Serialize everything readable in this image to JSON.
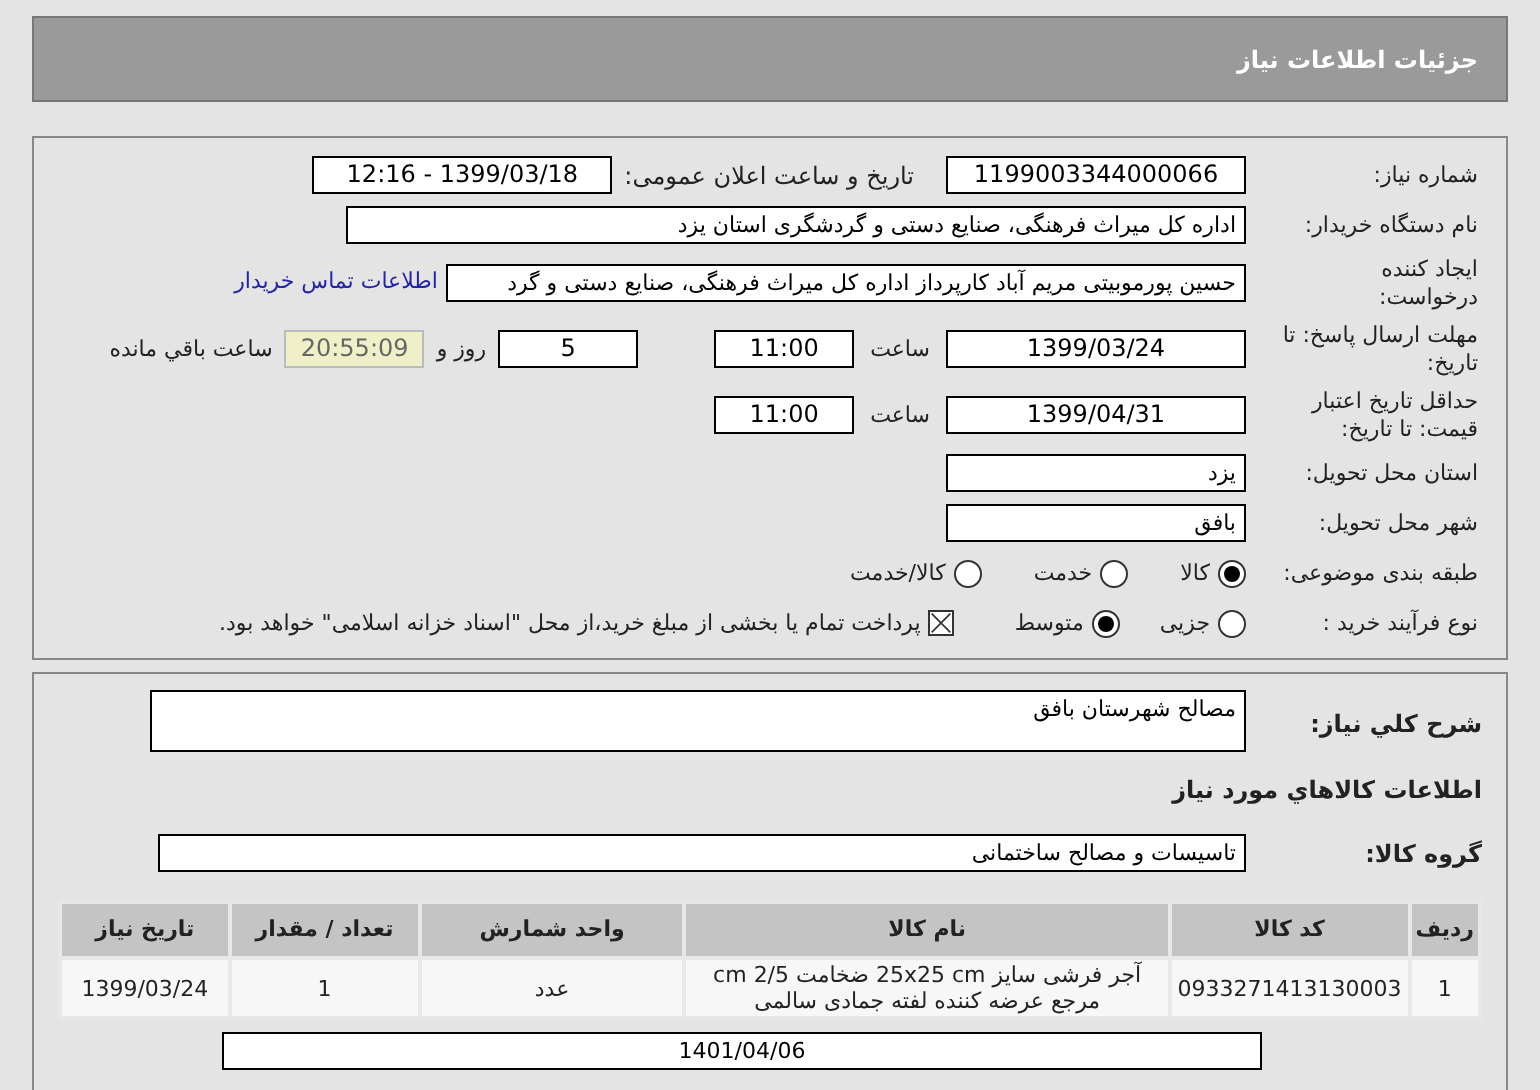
{
  "header": {
    "title": "جزئیات اطلاعات نیاز"
  },
  "need_number": {
    "label": "شماره نیاز:",
    "value": "1199003344000066"
  },
  "announce": {
    "label": "تاریخ و ساعت اعلان عمومی:",
    "value": "1399/03/18 - 12:16"
  },
  "buyer": {
    "label": "نام دستگاه خریدار:",
    "value": "اداره کل میراث فرهنگی، صنایع دستی و گردشگری استان یزد"
  },
  "creator": {
    "label": "ایجاد کننده درخواست:",
    "value": "حسین پورموبیتی مریم آباد کارپرداز اداره کل میراث فرهنگی، صنایع دستی و گرد",
    "link": "اطلاعات تماس خریدار"
  },
  "deadline": {
    "label": "مهلت ارسال پاسخ: تا تاریخ:",
    "date": "1399/03/24",
    "time_label": "ساعت",
    "time": "11:00",
    "days": "5",
    "days_label": "روز و",
    "remaining": "20:55:09",
    "remaining_label": "ساعت باقي مانده"
  },
  "validity": {
    "label": "حداقل تاریخ اعتبار قیمت: تا تاریخ:",
    "date": "1399/04/31",
    "time_label": "ساعت",
    "time": "11:00"
  },
  "province": {
    "label": "استان محل تحویل:",
    "value": "یزد"
  },
  "city": {
    "label": "شهر محل تحویل:",
    "value": "بافق"
  },
  "category": {
    "label": "طبقه بندی موضوعی:",
    "options": [
      {
        "label": "کالا",
        "selected": true
      },
      {
        "label": "خدمت",
        "selected": false
      },
      {
        "label": "کالا/خدمت",
        "selected": false
      }
    ]
  },
  "process": {
    "label": "نوع فرآیند خرید :",
    "options": [
      {
        "label": "جزیی",
        "selected": false
      },
      {
        "label": "متوسط",
        "selected": true
      }
    ],
    "treasury": {
      "checked": true,
      "label": "پرداخت تمام یا بخشی از مبلغ خرید،از محل \"اسناد خزانه اسلامی\" خواهد بود."
    }
  },
  "description": {
    "label": "شرح کلي نياز:",
    "value": "مصالح شهرستان بافق"
  },
  "goods_heading": "اطلاعات کالاهاي مورد نياز",
  "goods_group": {
    "label": "گروه کالا:",
    "value": "تاسیسات و مصالح ساختمانی"
  },
  "table": {
    "columns": [
      "ردیف",
      "کد کالا",
      "نام کالا",
      "واحد شمارش",
      "تعداد / مقدار",
      "تاریخ نیاز"
    ],
    "rows": [
      [
        "1",
        "0933271413130003",
        "آجر فرشی سایز 25x25 cm ضخامت 2/5 cm مرجع عرضه کننده لفته جمادی سالمی",
        "عدد",
        "1",
        "1399/03/24"
      ]
    ]
  },
  "bottom_field": {
    "value": "1401/04/06"
  }
}
